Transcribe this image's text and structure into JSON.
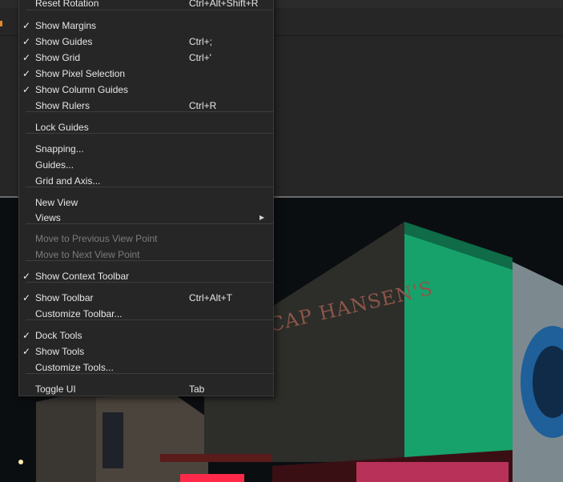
{
  "menu": {
    "items": [
      {
        "label": "Reset Rotation",
        "shortcut": "Ctrl+Alt+Shift+R",
        "checked": false,
        "disabled": false
      },
      {
        "label": "Show Margins",
        "shortcut": "",
        "checked": true,
        "disabled": false
      },
      {
        "label": "Show Guides",
        "shortcut": "Ctrl+;",
        "checked": true,
        "disabled": false
      },
      {
        "label": "Show Grid",
        "shortcut": "Ctrl+'",
        "checked": true,
        "disabled": false
      },
      {
        "label": "Show Pixel Selection",
        "shortcut": "",
        "checked": true,
        "disabled": false
      },
      {
        "label": "Show Column Guides",
        "shortcut": "",
        "checked": true,
        "disabled": false
      },
      {
        "label": "Show Rulers",
        "shortcut": "Ctrl+R",
        "checked": false,
        "disabled": false
      },
      {
        "label": "Lock Guides",
        "shortcut": "",
        "checked": false,
        "disabled": false
      },
      {
        "label": "Snapping...",
        "shortcut": "",
        "checked": false,
        "disabled": false
      },
      {
        "label": "Guides...",
        "shortcut": "",
        "checked": false,
        "disabled": false
      },
      {
        "label": "Grid and Axis...",
        "shortcut": "",
        "checked": false,
        "disabled": false
      },
      {
        "label": "New View",
        "shortcut": "",
        "checked": false,
        "disabled": false
      },
      {
        "label": "Views",
        "shortcut": "",
        "checked": false,
        "disabled": false,
        "submenu": true
      },
      {
        "label": "Move to Previous View Point",
        "shortcut": "",
        "checked": false,
        "disabled": true
      },
      {
        "label": "Move to Next View Point",
        "shortcut": "",
        "checked": false,
        "disabled": true
      },
      {
        "label": "Show Context Toolbar",
        "shortcut": "",
        "checked": true,
        "disabled": false
      },
      {
        "label": "Show Toolbar",
        "shortcut": "Ctrl+Alt+T",
        "checked": true,
        "disabled": false
      },
      {
        "label": "Customize Toolbar...",
        "shortcut": "",
        "checked": false,
        "disabled": false
      },
      {
        "label": "Dock Tools",
        "shortcut": "",
        "checked": true,
        "disabled": false
      },
      {
        "label": "Show Tools",
        "shortcut": "",
        "checked": true,
        "disabled": false
      },
      {
        "label": "Customize Tools...",
        "shortcut": "",
        "checked": false,
        "disabled": false
      },
      {
        "label": "Toggle UI",
        "shortcut": "Tab",
        "checked": false,
        "disabled": false
      }
    ],
    "check_glyph": "✓",
    "submenu_glyph": "▶"
  },
  "photo": {
    "sign_text": "CAP HANSEN'S",
    "colors": {
      "teal_wall": "#14a06a",
      "mural_blue": "#1f5f9a",
      "neon_red": "#ff2a4a",
      "sky": "#0c0f12"
    }
  }
}
